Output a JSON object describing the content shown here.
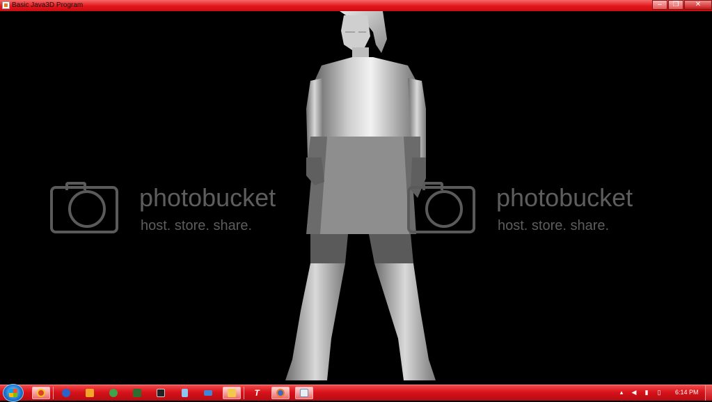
{
  "window": {
    "title": "Basic Java3D Program",
    "controls": {
      "minimize": "–",
      "maximize": "❐",
      "close": "✕"
    }
  },
  "scene": {
    "description_icon": "java3d-canvas",
    "watermark": {
      "brand": "photobucket",
      "tagline": "host. store. share."
    }
  },
  "taskbar": {
    "start_icon": "windows-logo-icon",
    "items": [
      {
        "name": "chrome-icon",
        "color": "#e0402b"
      },
      {
        "name": "ie-icon",
        "color": "#2a63c9"
      },
      {
        "name": "media-player-icon",
        "color": "#f2a526"
      },
      {
        "name": "paint-icon",
        "color": "#3ea34a"
      },
      {
        "name": "network-icon",
        "color": "#2e6d30"
      },
      {
        "name": "cmd-icon",
        "color": "#222222"
      },
      {
        "name": "notepad-icon",
        "color": "#8cc7f2"
      },
      {
        "name": "keyboard-icon",
        "color": "#3f86d9"
      },
      {
        "name": "explorer-icon",
        "color": "#f2c94c"
      },
      {
        "name": "text-tool-icon",
        "color": "#e11b1b"
      },
      {
        "name": "firefox-icon",
        "color": "#3c67c4"
      },
      {
        "name": "java-app-icon",
        "color": "#6d8fb8"
      }
    ],
    "clock": "6:14 PM",
    "tray_icons": [
      "arrow-up-icon",
      "volume-icon",
      "signal-icon",
      "battery-icon"
    ]
  }
}
